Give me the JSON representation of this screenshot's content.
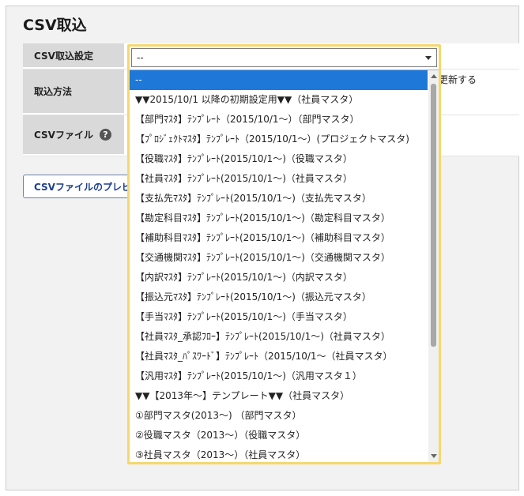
{
  "page": {
    "title": "CSV取込"
  },
  "form": {
    "settings_label": "CSV取込設定",
    "method_label": "取込方法",
    "method_tail": "更新する",
    "file_label": "CSVファイル",
    "help_glyph": "?"
  },
  "preview_button": "CSVファイルのプレビ",
  "select": {
    "value": "--",
    "options": [
      "--",
      "▼▼2015/10/1 以降の初期設定用▼▼（社員マスタ）",
      "【部門ﾏｽﾀ】ﾃﾝﾌﾟﾚｰﾄ（2015/10/1～）（部門マスタ）",
      "【ﾌﾟﾛｼﾞｪｸﾄﾏｽﾀ】ﾃﾝﾌﾟﾚｰﾄ（2015/10/1～）(プロジェクトマスタ)",
      "【役職ﾏｽﾀ】ﾃﾝﾌﾟﾚｰﾄ(2015/10/1～)（役職マスタ）",
      "【社員ﾏｽﾀ】ﾃﾝﾌﾟﾚｰﾄ(2015/10/1～)（社員マスタ）",
      "【支払先ﾏｽﾀ】ﾃﾝﾌﾟﾚｰﾄ(2015/10/1～)（支払先マスタ）",
      "【勘定科目ﾏｽﾀ】ﾃﾝﾌﾟﾚｰﾄ(2015/10/1～)（勘定科目マスタ）",
      "【補助科目ﾏｽﾀ】ﾃﾝﾌﾟﾚｰﾄ(2015/10/1～)（補助科目マスタ）",
      "【交通機関ﾏｽﾀ】ﾃﾝﾌﾟﾚｰﾄ(2015/10/1～)（交通機関マスタ）",
      "【内訳ﾏｽﾀ】ﾃﾝﾌﾟﾚｰﾄ(2015/10/1～)（内訳マスタ）",
      "【振込元ﾏｽﾀ】ﾃﾝﾌﾟﾚｰﾄ(2015/10/1～)（振込元マスタ）",
      "【手当ﾏｽﾀ】ﾃﾝﾌﾟﾚｰﾄ(2015/10/1～)（手当マスタ）",
      "【社員ﾏｽﾀ_承認ﾌﾛｰ】ﾃﾝﾌﾟﾚｰﾄ(2015/10/1～)（社員マスタ）",
      "【社員ﾏｽﾀ_ﾊﾟｽﾜｰﾄﾞ】ﾃﾝﾌﾟﾚｰﾄ（2015/10/1～（社員マスタ）",
      "【汎用ﾏｽﾀ】ﾃﾝﾌﾟﾚｰﾄ(2015/10/1～)（汎用マスタ１）",
      "▼▼【2013年～】テンプレート▼▼（社員マスタ）",
      "①部門マスタ(2013～) （部門マスタ）",
      "②役職マスタ（2013～）（役職マスタ）",
      "③社員マスタ（2013～）（社員マスタ）"
    ]
  }
}
